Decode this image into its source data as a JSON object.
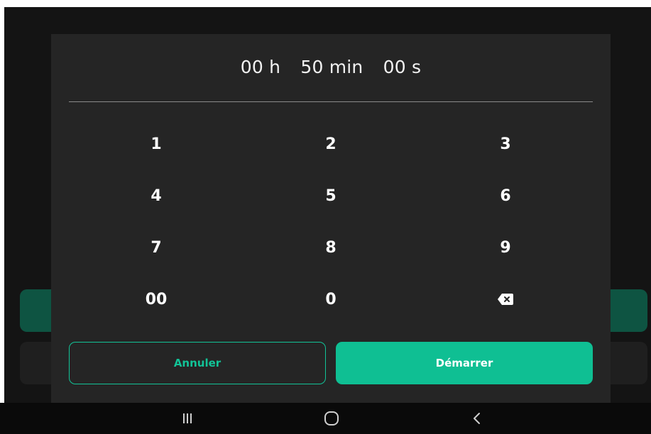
{
  "timer": {
    "hours": "00 h",
    "minutes": "50 min",
    "seconds": "00 s"
  },
  "keypad": {
    "keys": [
      "1",
      "2",
      "3",
      "4",
      "5",
      "6",
      "7",
      "8",
      "9",
      "00",
      "0"
    ],
    "backspace_icon": "backspace-icon"
  },
  "actions": {
    "cancel_label": "Annuler",
    "start_label": "Démarrer"
  },
  "navbar": {
    "recents_icon": "recents-icon",
    "home_icon": "home-icon",
    "back_icon": "back-icon"
  },
  "colors": {
    "accent": "#0fbf93",
    "dialog_bg": "#252525",
    "screen_bg": "#141414",
    "dim_accent": "#0e5442"
  }
}
